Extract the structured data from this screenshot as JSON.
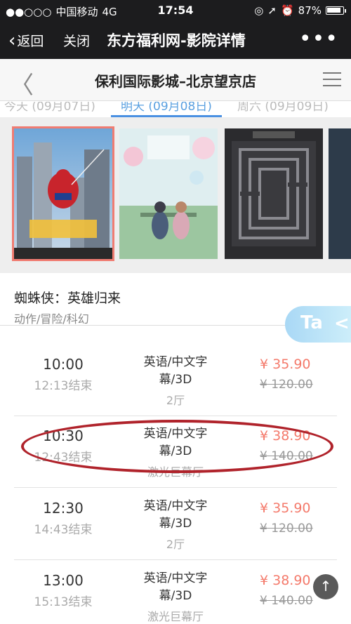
{
  "status_bar": {
    "signal": "●●○○○",
    "carrier": "中国移动",
    "network": "4G",
    "time": "17:54",
    "battery_text": "87%",
    "battery_level": 0.87
  },
  "wechat_nav": {
    "back_label": "返回",
    "close_label": "关闭",
    "title": "东方福利网-影院详情",
    "more_label": "•••"
  },
  "page_header": {
    "back_glyph": "〈",
    "title": "保利国际影城–北京望京店"
  },
  "date_tabs": [
    {
      "label": "今天 (09月07日)"
    },
    {
      "label": "明天 (09月08日)"
    },
    {
      "label": "周六 (09月09日)"
    }
  ],
  "posters": [
    {
      "name": "蜘蛛侠",
      "selected": true
    },
    {
      "name": "声之形",
      "selected": false
    },
    {
      "name": "黑白迷宫",
      "selected": false
    }
  ],
  "movie": {
    "title": "蜘蛛侠：英雄归来",
    "genre": "动作/冒险/科幻"
  },
  "ta_button": {
    "label": "Ta",
    "share_glyph": "<"
  },
  "sessions": [
    {
      "time": "10:00",
      "end": "12:13结束",
      "lang_line1": "英语/中文字",
      "lang_line2": "幕/3D",
      "hall": "2厅",
      "price": "¥ 35.90",
      "original_price": "¥ 120.00"
    },
    {
      "time": "10:30",
      "end": "12:43结束",
      "lang_line1": "英语/中文字",
      "lang_line2": "幕/3D",
      "hall": "激光巨幕厅",
      "price": "¥ 38.90",
      "original_price": "¥ 140.00"
    },
    {
      "time": "12:30",
      "end": "14:43结束",
      "lang_line1": "英语/中文字",
      "lang_line2": "幕/3D",
      "hall": "2厅",
      "price": "¥ 35.90",
      "original_price": "¥ 120.00"
    },
    {
      "time": "13:00",
      "end": "15:13结束",
      "lang_line1": "英语/中文字",
      "lang_line2": "幕/3D",
      "hall": "激光巨幕厅",
      "price": "¥ 38.90",
      "original_price": "¥ 140.00"
    }
  ],
  "scroll_top_glyph": "↑",
  "colors": {
    "price": "#f47a6b",
    "accent": "#4a90e2",
    "annotation": "#b0232b"
  }
}
